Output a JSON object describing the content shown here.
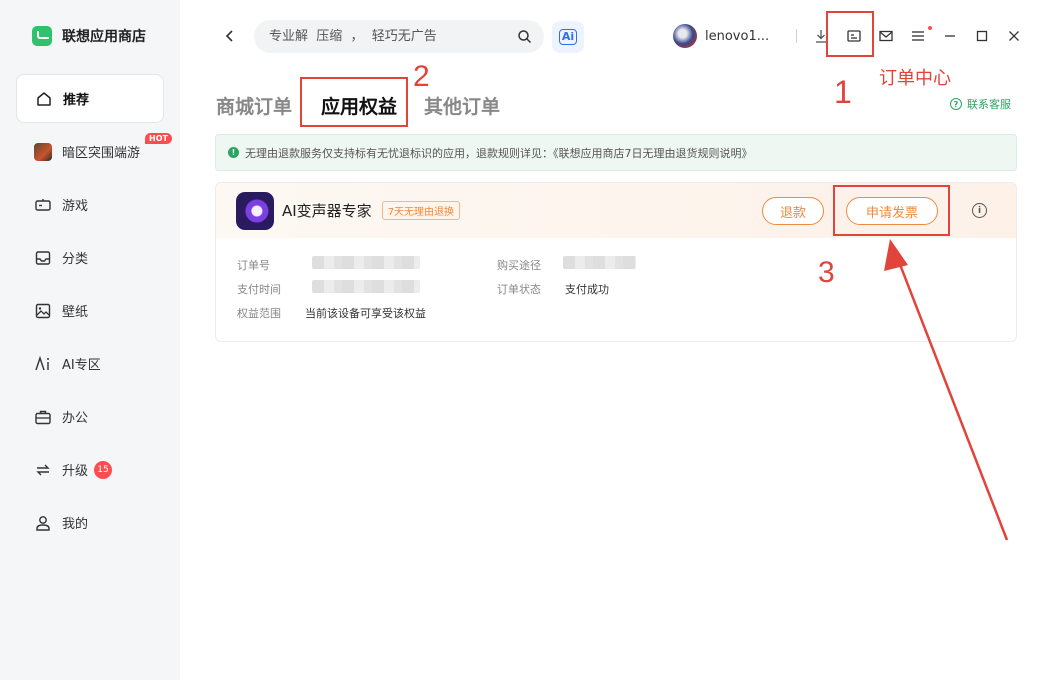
{
  "app": {
    "name": "联想应用商店"
  },
  "sidebar": {
    "items": [
      {
        "label": "推荐",
        "icon": "home-icon"
      },
      {
        "label": "暗区突围端游",
        "icon": "game-thumbnail-icon",
        "badge": "HOT"
      },
      {
        "label": "游戏",
        "icon": "gamepad-icon"
      },
      {
        "label": "分类",
        "icon": "inbox-icon"
      },
      {
        "label": "壁纸",
        "icon": "image-icon"
      },
      {
        "label": "AI专区",
        "icon": "ai-icon"
      },
      {
        "label": "办公",
        "icon": "briefcase-icon"
      },
      {
        "label": "升级",
        "icon": "update-icon",
        "count": "15"
      },
      {
        "label": "我的",
        "icon": "user-icon"
      }
    ]
  },
  "search": {
    "placeholder": "专业解  压缩  ，  轻巧无广告"
  },
  "ai_button": {
    "label": "Ai"
  },
  "user": {
    "name": "lenovo1..."
  },
  "tabs": [
    {
      "label": "商城订单"
    },
    {
      "label": "应用权益"
    },
    {
      "label": "其他订单"
    }
  ],
  "service_link": "联系客服",
  "notice": "无理由退款服务仅支持标有无忧退标识的应用，退款规则详见：《联想应用商店7日无理由退货规则说明》",
  "order": {
    "app_name": "AI变声器专家",
    "tag": "7天无理由退换",
    "refund_label": "退款",
    "invoice_label": "申请发票",
    "fields": {
      "order_no_label": "订单号",
      "pay_time_label": "支付时间",
      "scope_label": "权益范围",
      "scope_value": "当前该设备可享受该权益",
      "channel_label": "购买途径",
      "status_label": "订单状态",
      "status_value": "支付成功"
    }
  },
  "annotations": {
    "step1": "1",
    "step1_caption": "订单中心",
    "step2": "2",
    "step3": "3",
    "color": "#e0443a"
  }
}
